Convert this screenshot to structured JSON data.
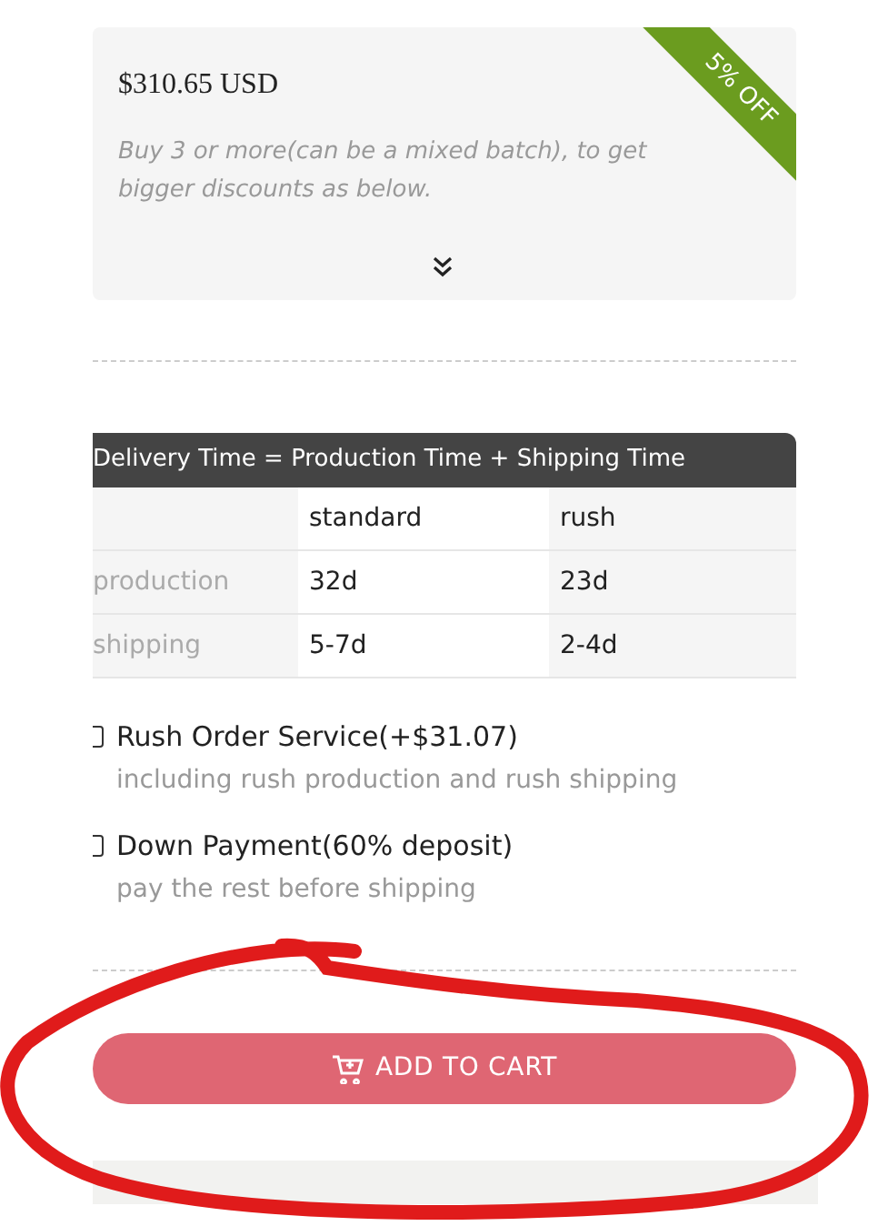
{
  "discount_card": {
    "price": "$310.65 USD",
    "badge": "5% OFF",
    "note": "Buy 3 or more(can be a mixed batch), to get bigger discounts as below.",
    "expanded": false
  },
  "delivery_table": {
    "title": "Delivery Time = Production Time + Shipping Time",
    "columns": [
      "standard",
      "rush"
    ],
    "rows": [
      {
        "label": "production",
        "cells": [
          "32d",
          "23d"
        ]
      },
      {
        "label": "shipping",
        "cells": [
          "5-7d",
          "2-4d"
        ]
      }
    ]
  },
  "options": [
    {
      "label": "Rush Order Service(+$31.07)",
      "note": "including rush production and rush shipping",
      "checked": false
    },
    {
      "label": "Down Payment(60% deposit)",
      "note": "pay the rest before shipping",
      "checked": false
    }
  ],
  "add_to_cart": {
    "label": "ADD TO CART"
  }
}
